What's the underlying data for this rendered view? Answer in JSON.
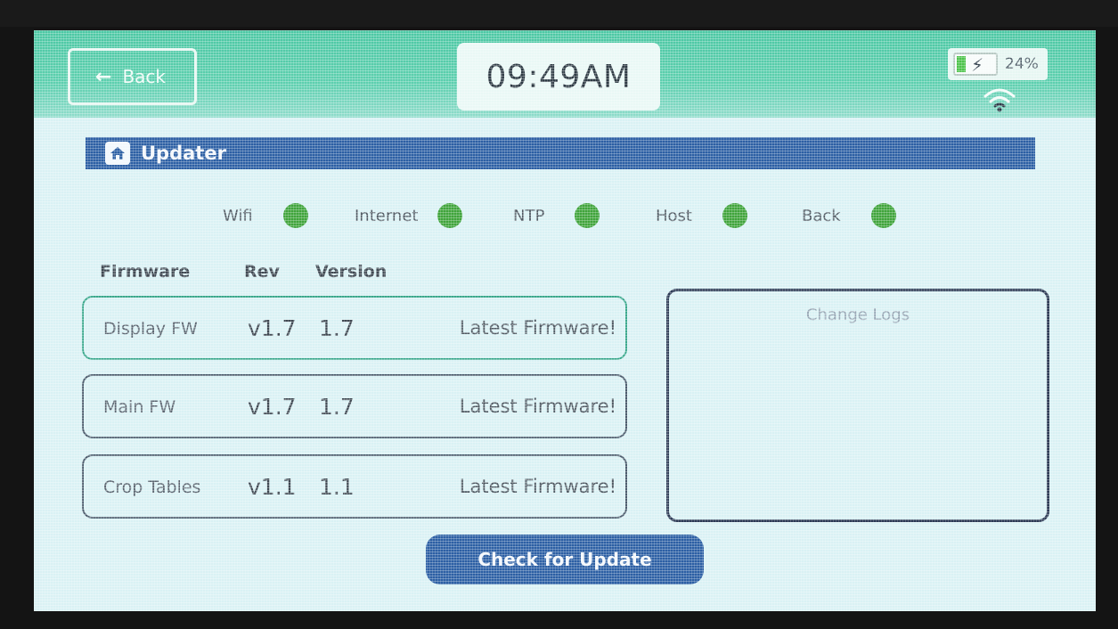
{
  "header": {
    "back_label": "Back",
    "time": "09:49AM",
    "battery_percent_label": "24%",
    "battery_level": 0.24
  },
  "title": "Updater",
  "status": [
    {
      "label": "Wifi",
      "state": "ok"
    },
    {
      "label": "Internet",
      "state": "ok"
    },
    {
      "label": "NTP",
      "state": "ok"
    },
    {
      "label": "Host",
      "state": "ok"
    },
    {
      "label": "Back",
      "state": "ok"
    }
  ],
  "table": {
    "headers": [
      "Firmware",
      "Rev",
      "Version"
    ],
    "rows": [
      {
        "name": "Display FW",
        "rev": "v1.7",
        "version": "1.7",
        "status": "Latest Firmware!"
      },
      {
        "name": "Main FW",
        "rev": "v1.7",
        "version": "1.7",
        "status": "Latest Firmware!"
      },
      {
        "name": "Crop Tables",
        "rev": "v1.1",
        "version": "1.1",
        "status": "Latest Firmware!"
      }
    ]
  },
  "changelog_title": "Change Logs",
  "check_button": "Check for Update",
  "colors": {
    "header": "#4bc7a3",
    "title_bar": "#2c5fa4",
    "status_ok": "#3fa43b",
    "button": "#2c5fa4"
  }
}
